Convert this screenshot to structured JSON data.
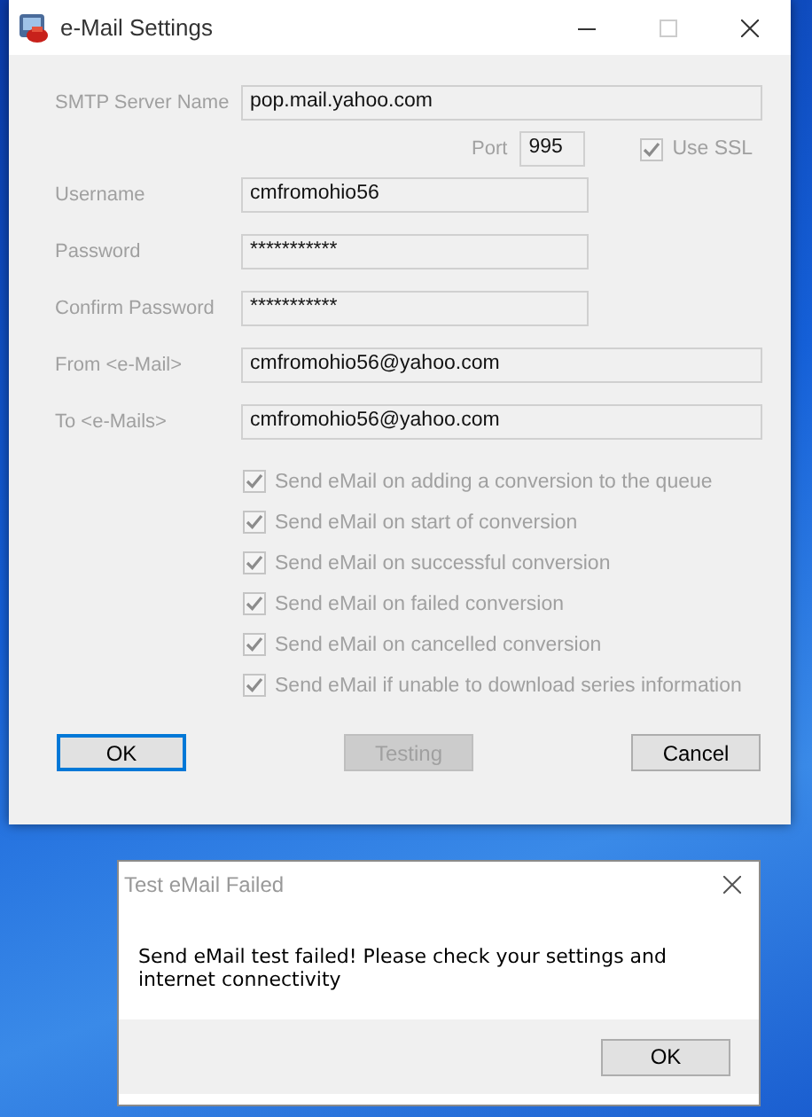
{
  "window": {
    "title": "e-Mail Settings"
  },
  "server": {
    "label": "SMTP Server Name",
    "value": "pop.mail.yahoo.com",
    "disabled": true
  },
  "port": {
    "label": "Port",
    "value": "995",
    "disabled": true
  },
  "ssl": {
    "label": "Use SSL",
    "checked": true,
    "disabled": true
  },
  "fields": [
    {
      "label": "Username",
      "value": "cmfromohio56",
      "disabled": true
    },
    {
      "label": "Password",
      "value": "***********",
      "disabled": true
    },
    {
      "label": "Confirm Password",
      "value": "***********",
      "disabled": true
    },
    {
      "label": "From <e-Mail>",
      "value": "cmfromohio56@yahoo.com",
      "disabled": true
    },
    {
      "label": "To <e-Mails>",
      "value": "cmfromohio56@yahoo.com",
      "disabled": true
    }
  ],
  "options": [
    {
      "label": "Send eMail on adding a conversion to the queue",
      "checked": true,
      "disabled": true
    },
    {
      "label": "Send eMail on start of conversion",
      "checked": true,
      "disabled": true
    },
    {
      "label": "Send eMail on successful conversion",
      "checked": true,
      "disabled": true
    },
    {
      "label": "Send eMail on failed conversion",
      "checked": true,
      "disabled": true
    },
    {
      "label": "Send eMail on cancelled conversion",
      "checked": true,
      "disabled": true
    },
    {
      "label": "Send eMail if unable to download series information",
      "checked": true,
      "disabled": true
    }
  ],
  "buttons": [
    {
      "label": "OK",
      "disabled": false,
      "focused": true
    },
    {
      "label": "Testing",
      "disabled": true,
      "focused": false
    },
    {
      "label": "Cancel",
      "disabled": false,
      "focused": false
    }
  ],
  "dialog": {
    "title": "Test eMail Failed",
    "message": "Send eMail test failed! Please check your settings and internet connectivity",
    "button": "OK"
  }
}
